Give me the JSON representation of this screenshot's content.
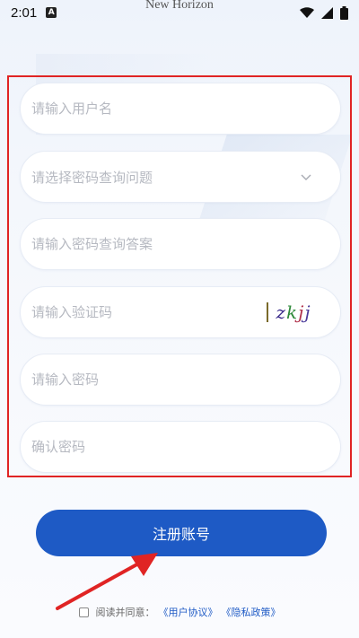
{
  "status_bar": {
    "time": "2:01",
    "notification_badge": "A",
    "icons": [
      "wifi-icon",
      "signal-icon",
      "battery-icon"
    ]
  },
  "app_title": "New Horizon",
  "form": {
    "username_placeholder": "请输入用户名",
    "question_placeholder": "请选择密码查询问题",
    "answer_placeholder": "请输入密码查询答案",
    "captcha_placeholder": "请输入验证码",
    "captcha_text": "zkjj",
    "password_placeholder": "请输入密码",
    "confirm_placeholder": "确认密码"
  },
  "register_label": "注册账号",
  "agreement": {
    "prefix": "阅读并同意：",
    "user_agreement": "《用户协议》",
    "privacy_policy": "《隐私政策》"
  },
  "colors": {
    "accent": "#1e5ac5",
    "annotation": "#e02424",
    "placeholder": "#b6b9c1"
  }
}
